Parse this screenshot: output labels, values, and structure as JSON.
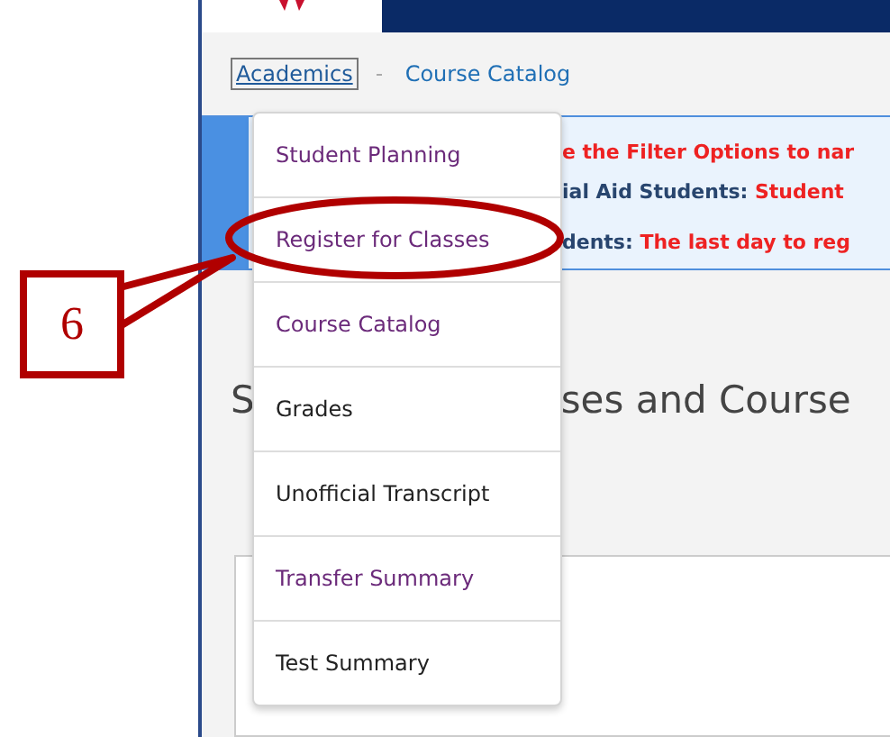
{
  "breadcrumb": [
    {
      "label": "Academics",
      "selected": true
    },
    {
      "label": "Course Catalog",
      "selected": false
    }
  ],
  "notice_lines": [
    [
      {
        "text": "e the Filter Options to nar",
        "kind": "alert"
      }
    ],
    [
      {
        "text": "ial Aid Students: ",
        "kind": "label"
      },
      {
        "text": "Student",
        "kind": "alert"
      }
    ],
    [
      {
        "text": "dents:  ",
        "kind": "label"
      },
      {
        "text": "The last day to reg",
        "kind": "alert"
      }
    ]
  ],
  "page_title_parts": [
    "S",
    "ses and Course"
  ],
  "menu": [
    {
      "label": "Student Planning",
      "visited": true
    },
    {
      "label": "Register for Classes",
      "visited": true
    },
    {
      "label": "Course Catalog",
      "visited": true
    },
    {
      "label": "Grades",
      "visited": false
    },
    {
      "label": "Unofficial Transcript",
      "visited": false
    },
    {
      "label": "Transfer Summary",
      "visited": true
    },
    {
      "label": "Test Summary",
      "visited": false
    }
  ],
  "callout": {
    "number": "6"
  }
}
